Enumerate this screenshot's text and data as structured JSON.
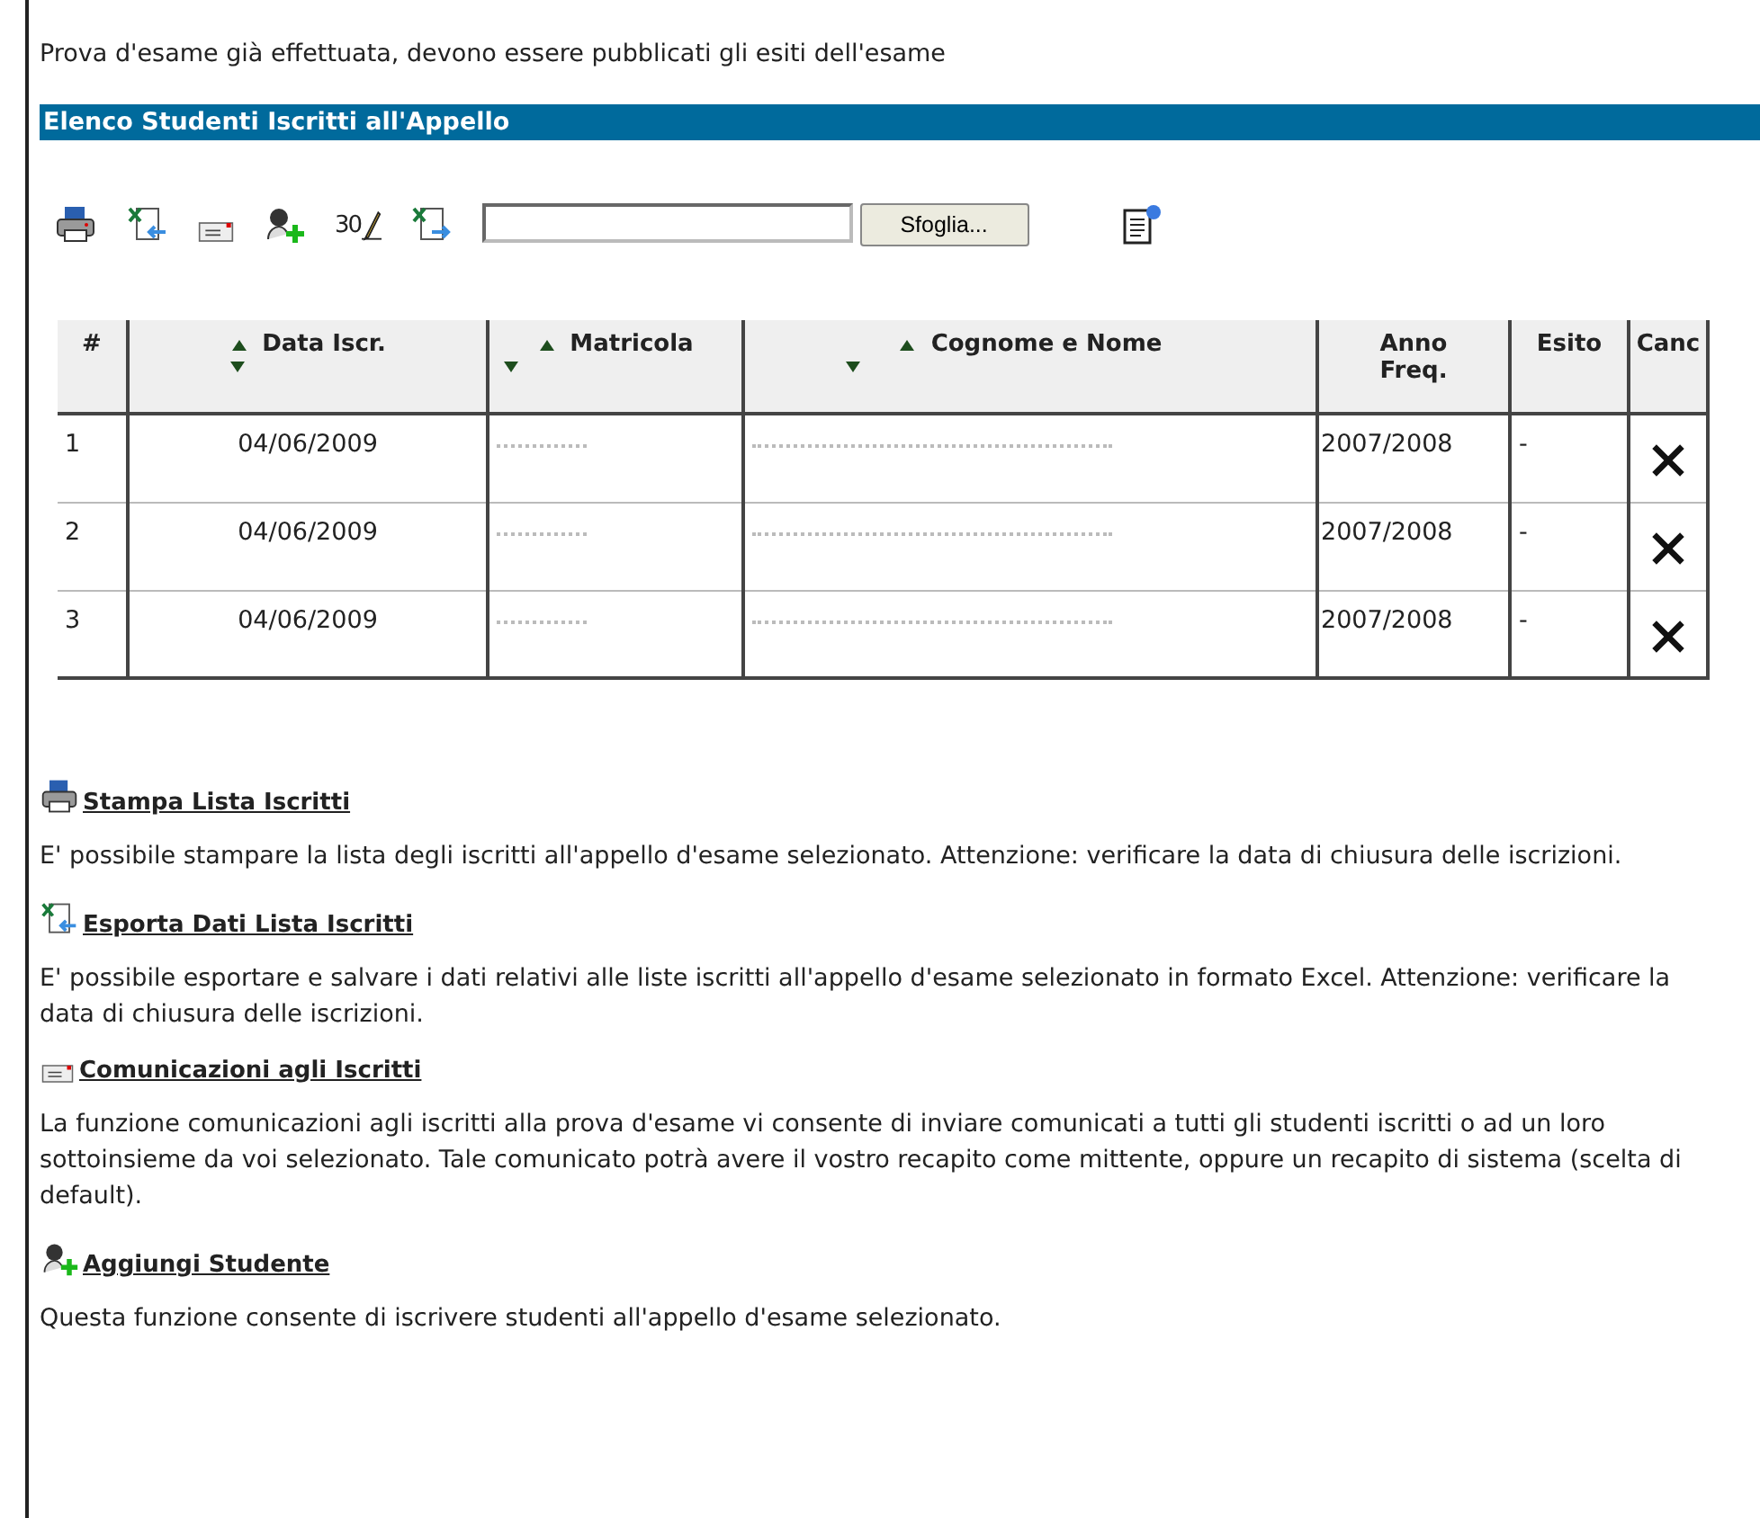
{
  "status_message": "Prova d'esame già effettuata, devono essere pubblicati gli esiti dell'esame",
  "section_title": "Elenco Studenti Iscritti all'Appello",
  "toolbar": [
    {
      "kind": "print"
    },
    {
      "kind": "export"
    },
    {
      "kind": "message"
    },
    {
      "kind": "add-student"
    },
    {
      "kind": "grade",
      "label": "30"
    },
    {
      "kind": "import"
    },
    {
      "kind": "file"
    },
    {
      "kind": "report"
    }
  ],
  "file_button": "Sfoglia...",
  "table": {
    "columns": [
      {
        "label": "#",
        "sortable": false
      },
      {
        "label": "Data Iscr.",
        "sortable": true
      },
      {
        "label": "Matricola",
        "sortable": true
      },
      {
        "label": "Cognome e Nome",
        "sortable": true
      },
      {
        "label": "Anno Freq.",
        "sortable": false
      },
      {
        "label": "Esito",
        "sortable": false
      },
      {
        "label": "Canc",
        "sortable": false
      }
    ],
    "rows": [
      {
        "index": "1",
        "date": "04/06/2009",
        "year": "2007/2008",
        "result": "-"
      },
      {
        "index": "2",
        "date": "04/06/2009",
        "year": "2007/2008",
        "result": "-"
      },
      {
        "index": "3",
        "date": "04/06/2009",
        "year": "2007/2008",
        "result": "-"
      }
    ]
  },
  "sections": [
    {
      "kind": "print",
      "title": "Stampa Lista Iscritti",
      "text": "E' possibile stampare la lista degli iscritti all'appello d'esame selezionato. Attenzione: verificare la data di chiusura delle iscrizioni."
    },
    {
      "kind": "export",
      "title": "Esporta Dati Lista Iscritti",
      "text": "E' possibile esportare e salvare i dati relativi alle liste iscritti all'appello d'esame selezionato in formato Excel. Attenzione: verificare la data di chiusura delle iscrizioni."
    },
    {
      "kind": "message",
      "title": "Comunicazioni agli Iscritti",
      "text": "La funzione comunicazioni agli iscritti alla prova d'esame vi consente di inviare comunicati a tutti gli studenti iscritti o ad un loro sottoinsieme da voi selezionato. Tale comunicato potrà avere il vostro recapito come mittente, oppure un recapito di sistema (scelta di default)."
    },
    {
      "kind": "add-student",
      "title": "Aggiungi Studente",
      "text": "Questa funzione consente di iscrivere studenti all'appello d'esame selezionato."
    }
  ]
}
